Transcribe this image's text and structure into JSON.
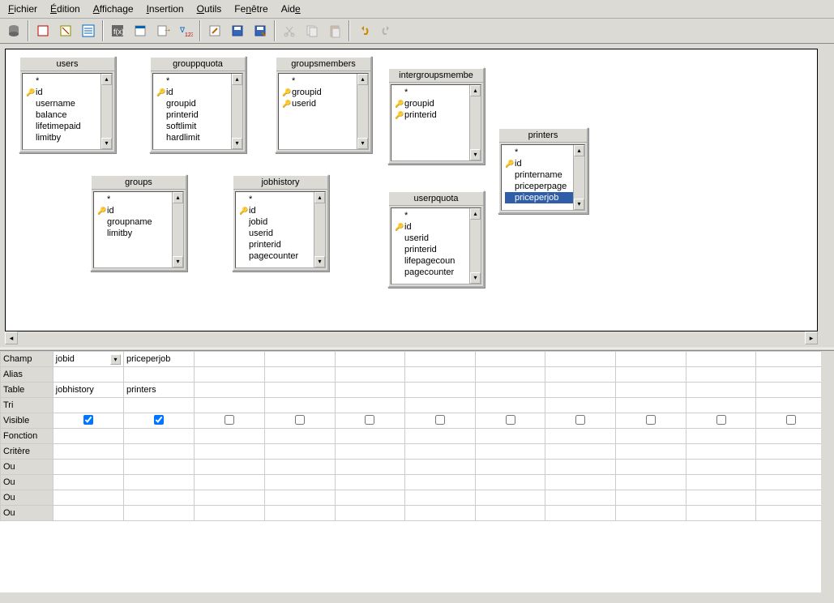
{
  "menu": {
    "file": "Fichier",
    "edit": "Édition",
    "view": "Affichage",
    "insert": "Insertion",
    "tools": "Outils",
    "window": "Fenêtre",
    "help": "Aide"
  },
  "tables": {
    "users": {
      "title": "users",
      "fields": [
        "*",
        "id",
        "username",
        "balance",
        "lifetimepaid",
        "limitby"
      ],
      "keys": [
        "id"
      ]
    },
    "grouppquota": {
      "title": "grouppquota",
      "fields": [
        "*",
        "id",
        "groupid",
        "printerid",
        "softlimit",
        "hardlimit"
      ],
      "keys": [
        "id"
      ]
    },
    "groupsmembers": {
      "title": "groupsmembers",
      "fields": [
        "*",
        "groupid",
        "userid"
      ],
      "keys": [
        "groupid",
        "userid"
      ]
    },
    "printergroupsmembers": {
      "title": "intergroupsmembe",
      "fields": [
        "*",
        "groupid",
        "printerid"
      ],
      "keys": [
        "groupid",
        "printerid"
      ]
    },
    "printers": {
      "title": "printers",
      "fields": [
        "*",
        "id",
        "printername",
        "priceperpage",
        "priceperjob"
      ],
      "keys": [
        "id"
      ],
      "selected": "priceperjob"
    },
    "groups": {
      "title": "groups",
      "fields": [
        "*",
        "id",
        "groupname",
        "limitby"
      ],
      "keys": [
        "id"
      ]
    },
    "jobhistory": {
      "title": "jobhistory",
      "fields": [
        "*",
        "id",
        "jobid",
        "userid",
        "printerid",
        "pagecounter"
      ],
      "keys": [
        "id"
      ]
    },
    "userpquota": {
      "title": "userpquota",
      "fields": [
        "*",
        "id",
        "userid",
        "printerid",
        "lifepagecoun",
        "pagecounter"
      ],
      "keys": [
        "id"
      ]
    }
  },
  "grid": {
    "headers": {
      "champ": "Champ",
      "alias": "Alias",
      "table": "Table",
      "tri": "Tri",
      "visible": "Visible",
      "fonction": "Fonction",
      "critere": "Critère",
      "ou": "Ou"
    },
    "columns": [
      {
        "champ": "jobid",
        "table": "jobhistory",
        "visible": true,
        "dropdown": true
      },
      {
        "champ": "priceperjob",
        "table": "printers",
        "visible": true
      },
      {
        "visible": false
      },
      {
        "visible": false
      },
      {
        "visible": false
      },
      {
        "visible": false
      },
      {
        "visible": false
      },
      {
        "visible": false
      },
      {
        "visible": false
      },
      {
        "visible": false
      },
      {
        "visible": false
      }
    ]
  }
}
